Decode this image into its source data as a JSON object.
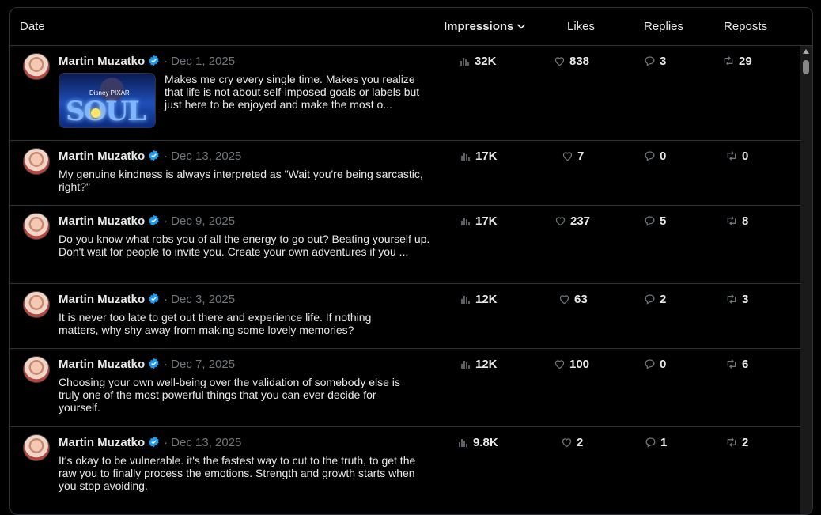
{
  "header": {
    "date": "Date",
    "impressions": "Impressions",
    "likes": "Likes",
    "replies": "Replies",
    "reposts": "Reposts"
  },
  "posts": [
    {
      "author": "Martin Muzatko",
      "date": "Dec 1, 2025",
      "has_image": true,
      "image_text": "SOUL",
      "image_brand": "Disney PIXAR",
      "text": "Makes me cry every single time. Makes you realize that life is not about self-imposed goals or labels but just here to be enjoyed and make the most o...",
      "impressions": "32K",
      "likes": "838",
      "replies": "3",
      "reposts": "29"
    },
    {
      "author": "Martin Muzatko",
      "date": "Dec 13, 2025",
      "text": "My genuine kindness is always interpreted as \"Wait you're being sarcastic, right?\"",
      "impressions": "17K",
      "likes": "7",
      "replies": "0",
      "reposts": "0"
    },
    {
      "author": "Martin Muzatko",
      "date": "Dec 9, 2025",
      "text": "Do you know what robs you of all the energy to go out? Beating yourself up.\nDon't wait for people to invite you. Create your own adventures if you ...",
      "impressions": "17K",
      "likes": "237",
      "replies": "5",
      "reposts": "8"
    },
    {
      "author": "Martin Muzatko",
      "date": "Dec 3, 2025",
      "text": "It is never too late to get out there and experience life. If nothing matters, why shy away from making some lovely memories?",
      "impressions": "12K",
      "likes": "63",
      "replies": "2",
      "reposts": "3"
    },
    {
      "author": "Martin Muzatko",
      "date": "Dec 7, 2025",
      "text": "Choosing your own well-being over the validation of somebody else is truly one of the most powerful things that you can ever decide for yourself.",
      "impressions": "12K",
      "likes": "100",
      "replies": "0",
      "reposts": "6"
    },
    {
      "author": "Martin Muzatko",
      "date": "Dec 13, 2025",
      "text": "It's okay to be vulnerable. it's the fastest way to cut to the truth, to get the raw you to finally process the emotions. Strength and growth starts when you stop avoiding.",
      "impressions": "9.8K",
      "likes": "2",
      "replies": "1",
      "reposts": "2"
    }
  ],
  "colors": {
    "background": "#000000",
    "border": "#2f3336",
    "muted": "#71767b",
    "verified": "#1d9bf0"
  }
}
